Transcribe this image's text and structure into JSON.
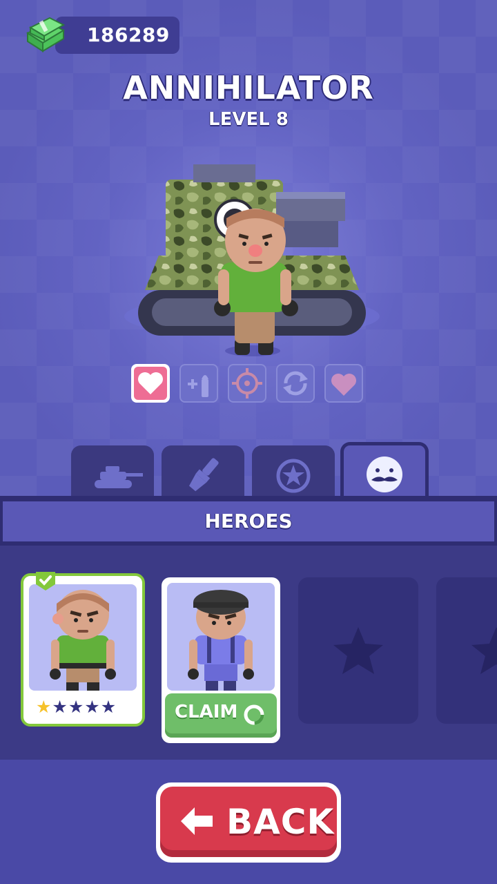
{
  "currency": {
    "amount": "186289",
    "icon": "cash-stack-icon"
  },
  "hero": {
    "name": "ANNIHILATOR",
    "level_label": "LEVEL 8"
  },
  "perks": [
    {
      "icon": "heart-icon",
      "active": true
    },
    {
      "icon": "ammo-plus-icon",
      "active": false
    },
    {
      "icon": "crosshair-icon",
      "active": false
    },
    {
      "icon": "reload-icon",
      "active": false
    },
    {
      "icon": "heart-icon",
      "active": false
    }
  ],
  "tabs": [
    {
      "icon": "tank-icon",
      "active": false
    },
    {
      "icon": "paint-brush-icon",
      "active": false
    },
    {
      "icon": "star-badge-icon",
      "active": false
    },
    {
      "icon": "mustache-face-icon",
      "active": true
    }
  ],
  "section": {
    "title": "HEROES"
  },
  "heroes": [
    {
      "state": "selected",
      "stars_filled": 1,
      "stars_total": 5
    },
    {
      "state": "claimable",
      "claim_label": "CLAIM"
    },
    {
      "state": "locked"
    },
    {
      "state": "locked"
    }
  ],
  "colors": {
    "accent_green": "#83c83b",
    "claim_green": "#6fbe69",
    "back_red": "#d83a4d",
    "star_gold": "#f6c22b"
  },
  "footer": {
    "back_label": "BACK"
  }
}
